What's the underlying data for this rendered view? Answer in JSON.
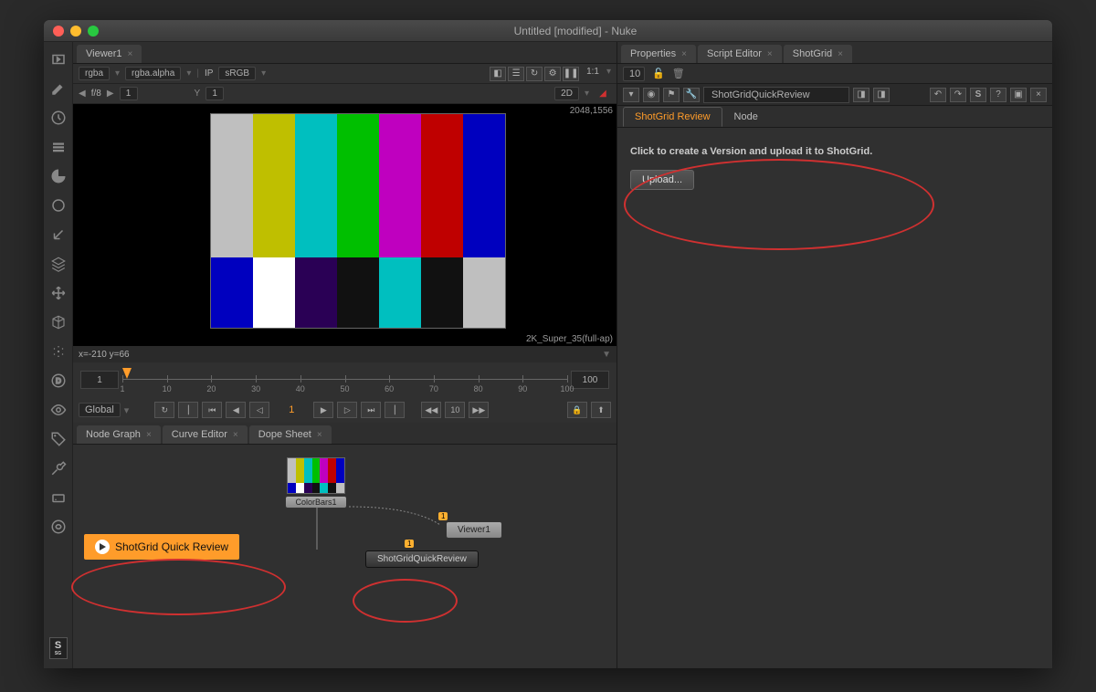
{
  "window": {
    "title": "Untitled [modified] - Nuke"
  },
  "viewer_tab": "Viewer1",
  "channels": {
    "rgba": "rgba",
    "alpha": "rgba.alpha",
    "ip": "IP",
    "colorspace": "sRGB"
  },
  "viewmode": {
    "ratio": "1:1",
    "space": "2D"
  },
  "fstop": "f/8",
  "frame_input": "1",
  "y_input": "1",
  "resolution": "2048,1556",
  "format": "2K_Super_35(full-ap)",
  "cursor_pos": "x=-210 y=66",
  "timeline": {
    "start": "1",
    "end": "100",
    "current": "1",
    "ticks": [
      "1",
      "10",
      "20",
      "30",
      "40",
      "50",
      "60",
      "70",
      "80",
      "90",
      "100"
    ]
  },
  "playback": {
    "range": "Global",
    "step": "10"
  },
  "lower_tabs": [
    "Node Graph",
    "Curve Editor",
    "Dope Sheet"
  ],
  "nodes": {
    "colorbars": "ColorBars1",
    "viewer": "Viewer1",
    "sgqr": "ShotGridQuickReview"
  },
  "tool_button": "ShotGrid Quick Review",
  "right_tabs": [
    "Properties",
    "Script Editor",
    "ShotGrid"
  ],
  "prop_count": "10",
  "node_name": "ShotGridQuickReview",
  "sub_tabs": [
    "ShotGrid Review",
    "Node"
  ],
  "instruction": "Click to create a Version and upload it to ShotGrid.",
  "upload_label": "Upload...",
  "s_label": "S",
  "viewer_connector": "1",
  "sg_label": "S",
  "sg_sub": "SG"
}
